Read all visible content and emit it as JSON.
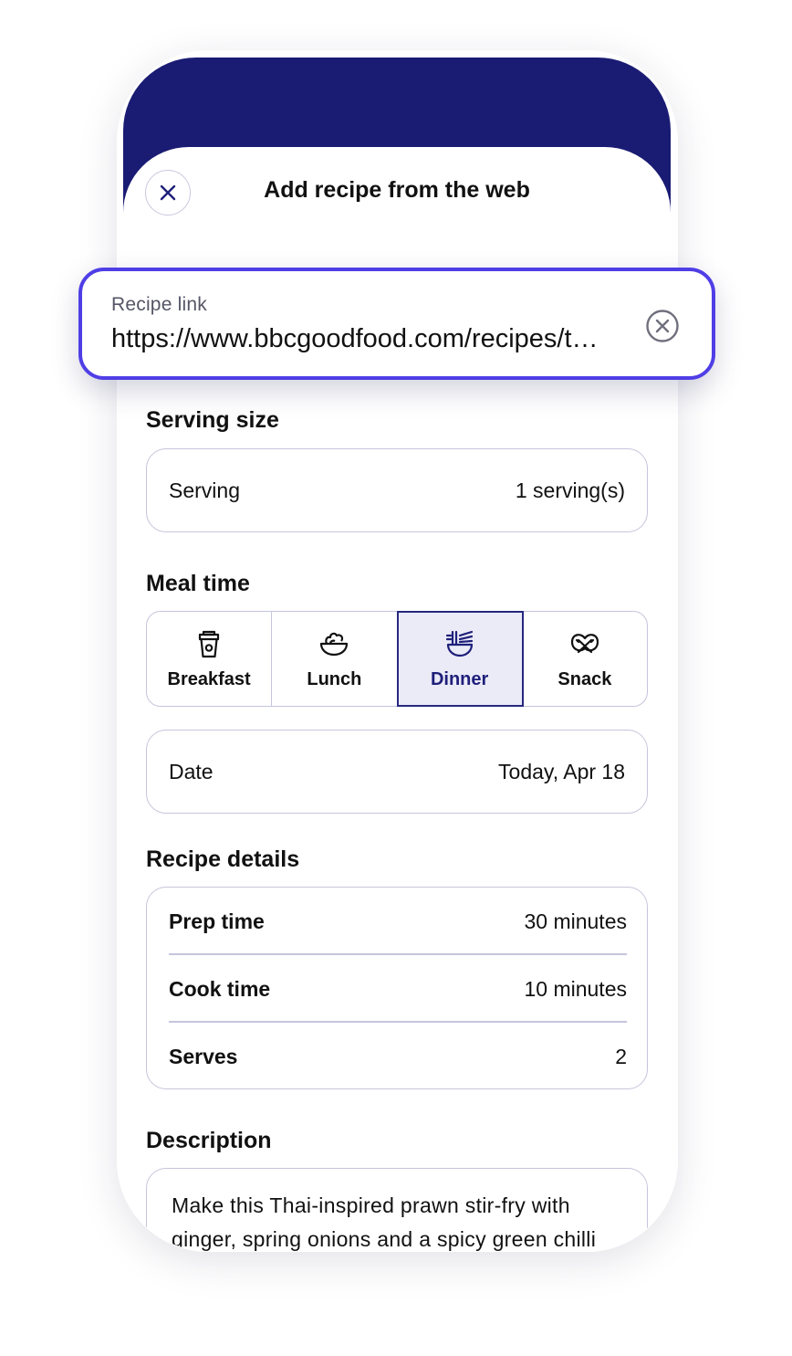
{
  "header": {
    "title": "Add recipe from the web"
  },
  "recipe_link": {
    "label": "Recipe link",
    "value": "https://www.bbcgoodfood.com/recipes/t…"
  },
  "serving": {
    "section_title": "Serving size",
    "label": "Serving",
    "value": "1 serving(s)"
  },
  "meal_time": {
    "section_title": "Meal time",
    "options": [
      {
        "label": "Breakfast",
        "icon": "coffee-cup-icon",
        "selected": false
      },
      {
        "label": "Lunch",
        "icon": "salad-bowl-icon",
        "selected": false
      },
      {
        "label": "Dinner",
        "icon": "noodle-bowl-icon",
        "selected": true
      },
      {
        "label": "Snack",
        "icon": "pretzel-icon",
        "selected": false
      }
    ]
  },
  "date": {
    "label": "Date",
    "value": "Today, Apr 18"
  },
  "recipe_details": {
    "section_title": "Recipe details",
    "rows": [
      {
        "label": "Prep time",
        "value": "30 minutes"
      },
      {
        "label": "Cook time",
        "value": "10 minutes"
      },
      {
        "label": "Serves",
        "value": "2"
      }
    ]
  },
  "description": {
    "section_title": "Description",
    "text": "Make this Thai-inspired prawn stir-fry with ginger, spring onions and a spicy green chilli"
  },
  "colors": {
    "header_navy": "#1a1b73",
    "accent_focus": "#4f3ee6",
    "selected_bg": "#ebebf8"
  }
}
